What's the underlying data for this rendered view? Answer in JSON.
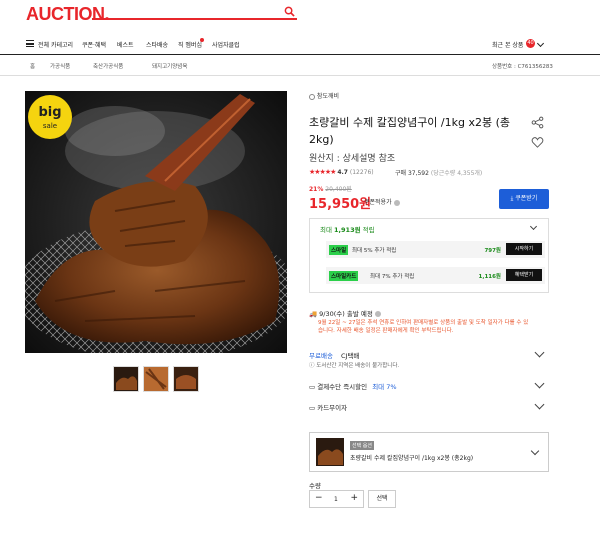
{
  "header": {
    "logo": "AUCTION.",
    "search_placeholder": ""
  },
  "nav": {
    "all_category": "전체 카테고리",
    "items": [
      "쿠폰·혜택",
      "베스트",
      "스타배송",
      "직 멤버십",
      "사업자클럽"
    ],
    "recent": "최근 본 상품",
    "recent_count": "40"
  },
  "breadcrumb": {
    "home": "홈",
    "items": [
      "가공식품",
      "축산가공식품",
      "돼지고기양념육"
    ],
    "product_no": "상품번호 : C761356283"
  },
  "product": {
    "image_badge_line1": "big",
    "image_badge_line2": "sale",
    "store": "참도깨비",
    "title": "초량갈비 수제 칼집양념구이 /1kg x2봉 (총2kg)",
    "origin": "원산지 : 상세설명 참조",
    "stars": "★★★★★",
    "rating": "4.7",
    "review_count": "(12276)",
    "purchase": "구매 37,592",
    "purchase_note": "(당근수량 4,355개)",
    "discount": "21%",
    "original_price": "20,400원",
    "price": "15,950원",
    "coupon_applied": "쿠폰적용가",
    "coupon_button": "쿠폰받기"
  },
  "points": {
    "header_prefix": "최대 ",
    "header_amount": "1,913원",
    "header_suffix": " 적립",
    "rows": [
      {
        "tag": "스마일",
        "text": "최대 5% 추가 적립",
        "amount": "797원",
        "button": "시작하기"
      },
      {
        "tag": "스마일카드",
        "text": "최대 7% 추가 적립",
        "amount": "1,116원",
        "button": "혜택받기"
      }
    ]
  },
  "shipping": {
    "date": "9/30(수) 출발 예정",
    "notice": "9월 22일 ~ 27일은 추석 연휴로 인하여 판매자별로 상품의 출발 및 도착 일자가 다를 수 있습니다. 자세한 배송 일정은 판매자에게 확인 부탁드립니다.",
    "free_label": "무료배송",
    "carrier": "CJ택배",
    "island_notice": "도서산간 지역은 배송이 불가합니다."
  },
  "payment": {
    "label": "결제수단 즉시할인",
    "max": "최대 7%"
  },
  "card_interest": {
    "label": "카드무이자"
  },
  "option": {
    "tag": "선택 옵션",
    "name": "초량갈비 수제 칼집양념구이 /1kg x2봉 (총2kg)"
  },
  "quantity": {
    "label": "수량",
    "value": "1",
    "select": "선택"
  },
  "colors": {
    "brand_red": "#e8262b",
    "blue": "#1d5ed8",
    "green": "#2bcf4a"
  }
}
